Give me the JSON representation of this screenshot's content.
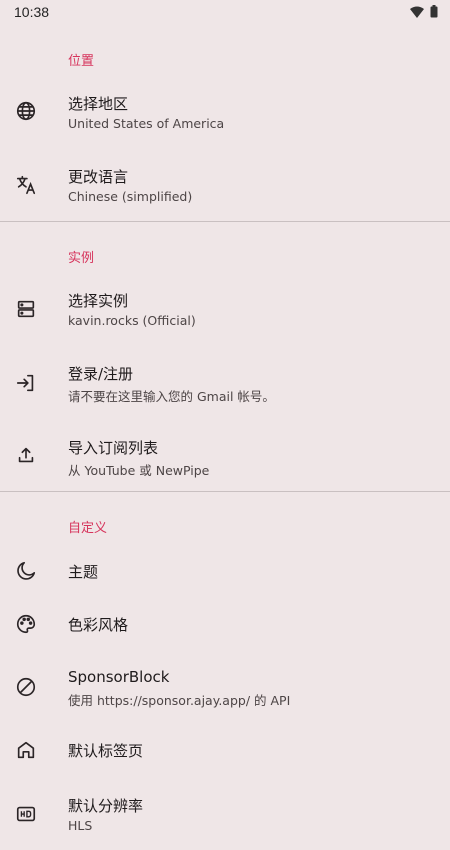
{
  "status_bar": {
    "time": "10:38"
  },
  "sections": [
    {
      "title": "位置"
    },
    {
      "title": "实例"
    },
    {
      "title": "自定义"
    }
  ],
  "items": {
    "region": {
      "title": "选择地区",
      "subtitle": "United States of America",
      "icon": "globe-icon"
    },
    "language": {
      "title": "更改语言",
      "subtitle": "Chinese (simplified)",
      "icon": "translate-icon"
    },
    "instance": {
      "title": "选择实例",
      "subtitle": "kavin.rocks (Official)",
      "icon": "dns-icon"
    },
    "login": {
      "title": "登录/注册",
      "subtitle": "请不要在这里输入您的 Gmail 帐号。",
      "icon": "login-icon"
    },
    "import": {
      "title": "导入订阅列表",
      "subtitle": "从 YouTube 或 NewPipe",
      "icon": "upload-icon"
    },
    "theme": {
      "title": "主题",
      "icon": "moon-icon"
    },
    "color_style": {
      "title": "色彩风格",
      "icon": "palette-icon"
    },
    "sponsorblock": {
      "title": "SponsorBlock",
      "subtitle": "使用 https://sponsor.ajay.app/ 的 API",
      "icon": "block-icon"
    },
    "default_tab": {
      "title": "默认标签页",
      "icon": "home-icon"
    },
    "default_resolution": {
      "title": "默认分辨率",
      "subtitle": "HLS",
      "icon": "hd-icon"
    }
  },
  "colors": {
    "accent": "#d6345c",
    "background": "#efe6e7",
    "divider": "#c9c0c1"
  }
}
